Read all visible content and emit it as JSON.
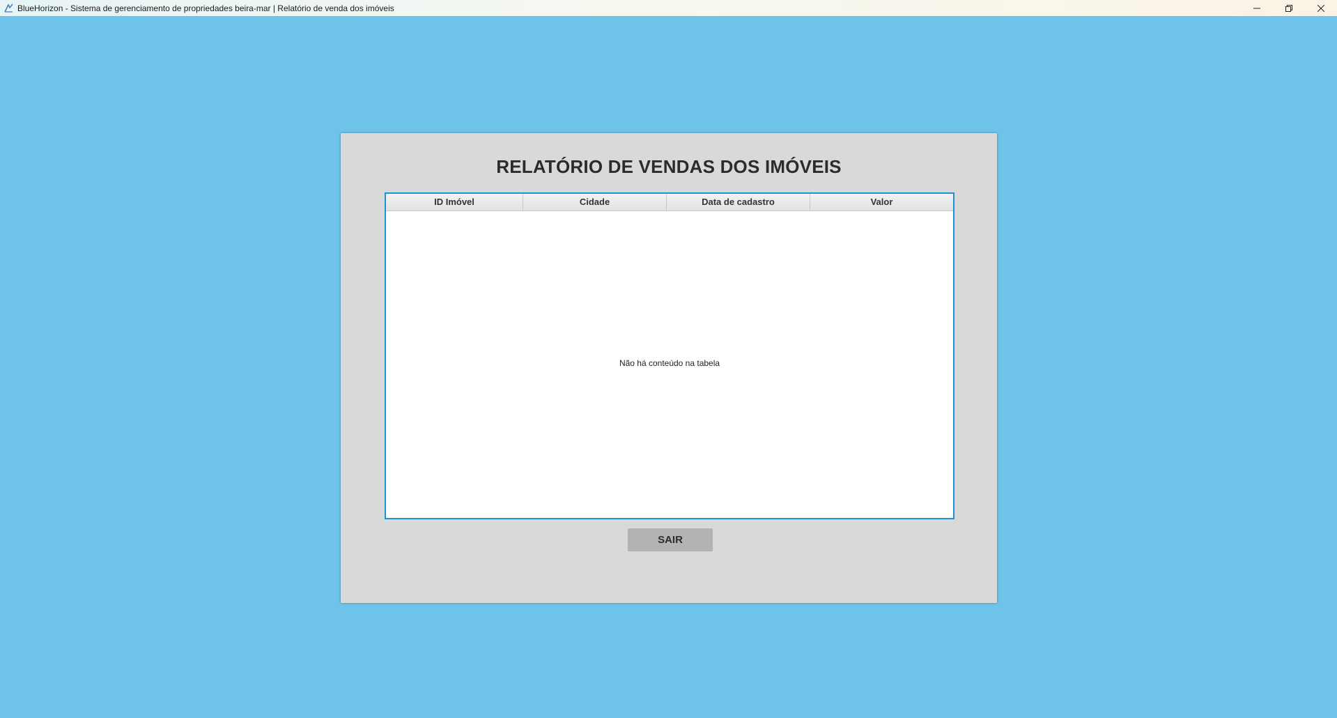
{
  "window": {
    "title": "BlueHorizon - Sistema de gerenciamento de propriedades beira-mar | Relatório de venda dos imóveis",
    "app_icon": "app-logo-icon",
    "controls": {
      "minimize": "—",
      "maximize": "❐",
      "close": "✕"
    }
  },
  "report": {
    "title": "RELATÓRIO DE VENDAS DOS IMÓVEIS",
    "table": {
      "columns": [
        "ID Imóvel",
        "Cidade",
        "Data de cadastro",
        "Valor"
      ],
      "rows": [],
      "empty_message": "Não há conteúdo na tabela"
    },
    "exit_button": "SAIR"
  },
  "colors": {
    "background": "#6ec3e8",
    "panel": "#d9d9d9",
    "table_border": "#1e90d6",
    "button": "#b3b3b3"
  }
}
